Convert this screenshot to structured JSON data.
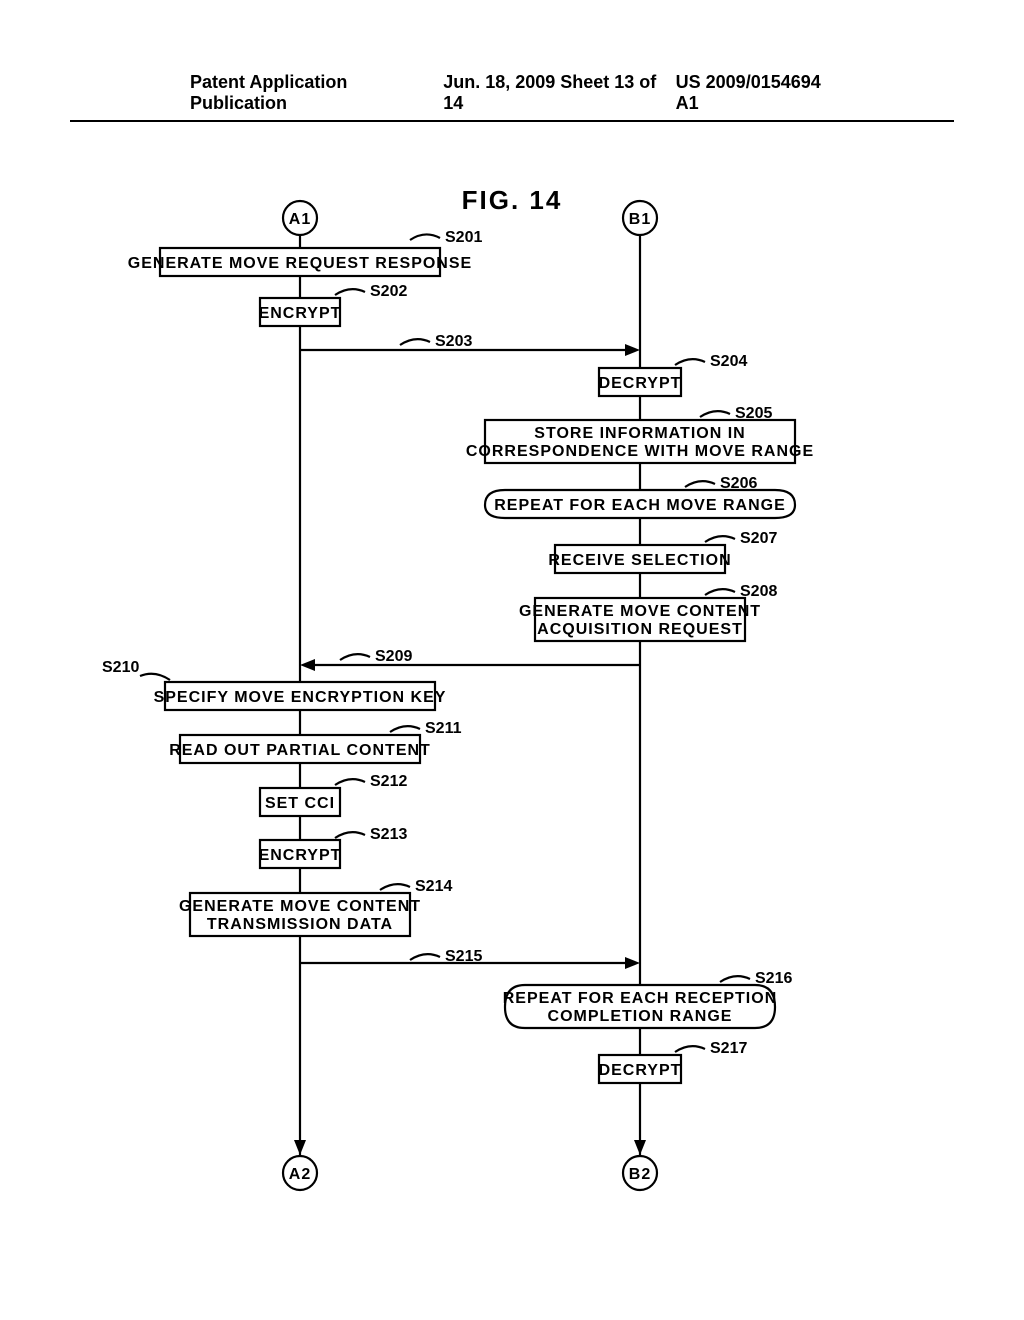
{
  "header": {
    "left": "Patent Application Publication",
    "mid": "Jun. 18, 2009  Sheet 13 of 14",
    "right": "US 2009/0154694 A1"
  },
  "fig": {
    "title": "FIG. 14"
  },
  "conn": {
    "a1": "A1",
    "b1": "B1",
    "a2": "A2",
    "b2": "B2"
  },
  "steps": {
    "s201": {
      "num": "S201",
      "text": "GENERATE MOVE REQUEST RESPONSE"
    },
    "s202": {
      "num": "S202",
      "text": "ENCRYPT"
    },
    "s203": {
      "num": "S203"
    },
    "s204": {
      "num": "S204",
      "text": "DECRYPT"
    },
    "s205": {
      "num": "S205",
      "line1": "STORE INFORMATION IN",
      "line2": "CORRESPONDENCE WITH MOVE RANGE"
    },
    "s206": {
      "num": "S206",
      "text": "REPEAT FOR EACH MOVE RANGE"
    },
    "s207": {
      "num": "S207",
      "text": "RECEIVE SELECTION"
    },
    "s208": {
      "num": "S208",
      "line1": "GENERATE MOVE CONTENT",
      "line2": "ACQUISITION REQUEST"
    },
    "s209": {
      "num": "S209"
    },
    "s210": {
      "num": "S210",
      "text": "SPECIFY MOVE ENCRYPTION KEY"
    },
    "s211": {
      "num": "S211",
      "text": "READ OUT PARTIAL CONTENT"
    },
    "s212": {
      "num": "S212",
      "text": "SET CCI"
    },
    "s213": {
      "num": "S213",
      "text": "ENCRYPT"
    },
    "s214": {
      "num": "S214",
      "line1": "GENERATE MOVE CONTENT",
      "line2": "TRANSMISSION DATA"
    },
    "s215": {
      "num": "S215"
    },
    "s216": {
      "num": "S216",
      "line1": "REPEAT FOR EACH RECEPTION",
      "line2": "COMPLETION RANGE"
    },
    "s217": {
      "num": "S217",
      "text": "DECRYPT"
    }
  }
}
